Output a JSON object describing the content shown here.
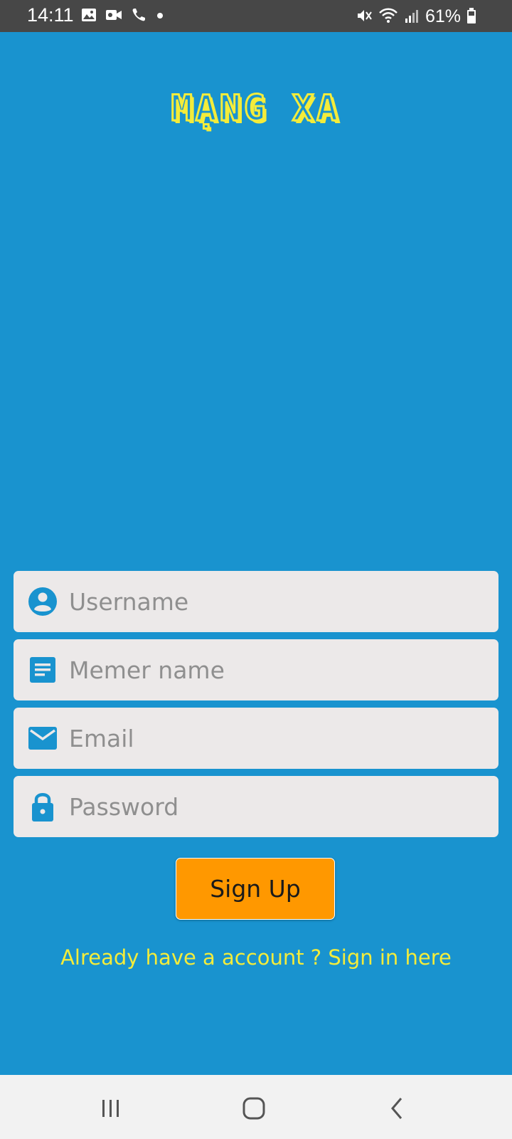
{
  "status_bar": {
    "time": "14:11",
    "battery": "61%",
    "left_icons": [
      "image-icon",
      "video-icon",
      "phone-icon",
      "dot-icon"
    ],
    "right_icons": [
      "mute-icon",
      "wifi-icon",
      "signal-icon",
      "battery-icon"
    ]
  },
  "app": {
    "logo": "MẠNG XA",
    "fields": [
      {
        "icon": "user-icon",
        "placeholder": "Username",
        "value": ""
      },
      {
        "icon": "document-icon",
        "placeholder": "Memer name",
        "value": ""
      },
      {
        "icon": "mail-icon",
        "placeholder": "Email",
        "value": ""
      },
      {
        "icon": "lock-icon",
        "placeholder": "Password",
        "value": ""
      }
    ],
    "signup_label": "Sign Up",
    "signin_link": "Already have a account ? Sign in here"
  },
  "colors": {
    "background": "#1993cf",
    "accent_yellow": "#f3ec3b",
    "button_orange": "#ff9800",
    "field_bg": "#ece9e9",
    "status_bar": "#474747"
  },
  "nav_bar": {
    "buttons": [
      "recent-apps-icon",
      "home-icon",
      "back-icon"
    ]
  }
}
